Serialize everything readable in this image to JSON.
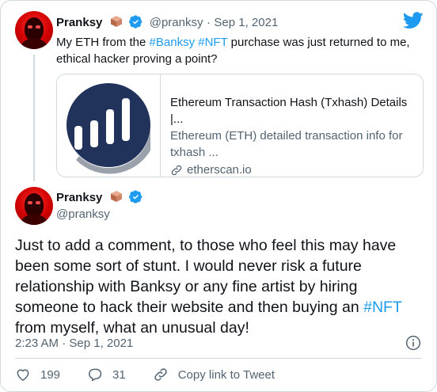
{
  "quoted_tweet": {
    "author_name": "Pranksy",
    "author_handle": "@pranksy",
    "separator": "·",
    "date": "Sep 1, 2021",
    "text_before": "My ETH from the ",
    "hashtag_1": "#Banksy",
    "hashtag_2": "#NFT",
    "text_line1_after": " purchase was just returned to me,",
    "text_line2": "ethical hacker proving a point?",
    "link_card": {
      "title": "Ethereum Transaction Hash (Txhash) Details |...",
      "description_line1": "Ethereum (ETH) detailed transaction info for",
      "description_line2": "txhash ...",
      "domain": "etherscan.io"
    }
  },
  "main_tweet": {
    "author_name": "Pranksy",
    "author_handle": "@pranksy",
    "body_line1": "Just to add a comment, to those who feel this may have",
    "body_line2": "been some sort of stunt. I would never risk a future",
    "body_line3": "relationship with Banksy or any fine artist by hiring",
    "body_line4": "someone to hack their website and then buying an ",
    "body_hashtag": "#NFT",
    "body_line5": "from myself, what an unusual day!",
    "timestamp": "2:23 AM · Sep 1, 2021"
  },
  "actions": {
    "likes": "199",
    "replies": "31",
    "copy_link_label": "Copy link to Tweet"
  },
  "colors": {
    "accent": "#1d9bf0",
    "verified": "#1d9bf0",
    "text": "#0f1419",
    "muted": "#536471",
    "border": "#cfd9de",
    "etherscan_blue": "#21325b"
  },
  "icons": [
    "twitter-bird-icon",
    "verified-badge-icon",
    "package-box-icon",
    "link-icon",
    "info-icon",
    "heart-icon",
    "reply-icon"
  ]
}
